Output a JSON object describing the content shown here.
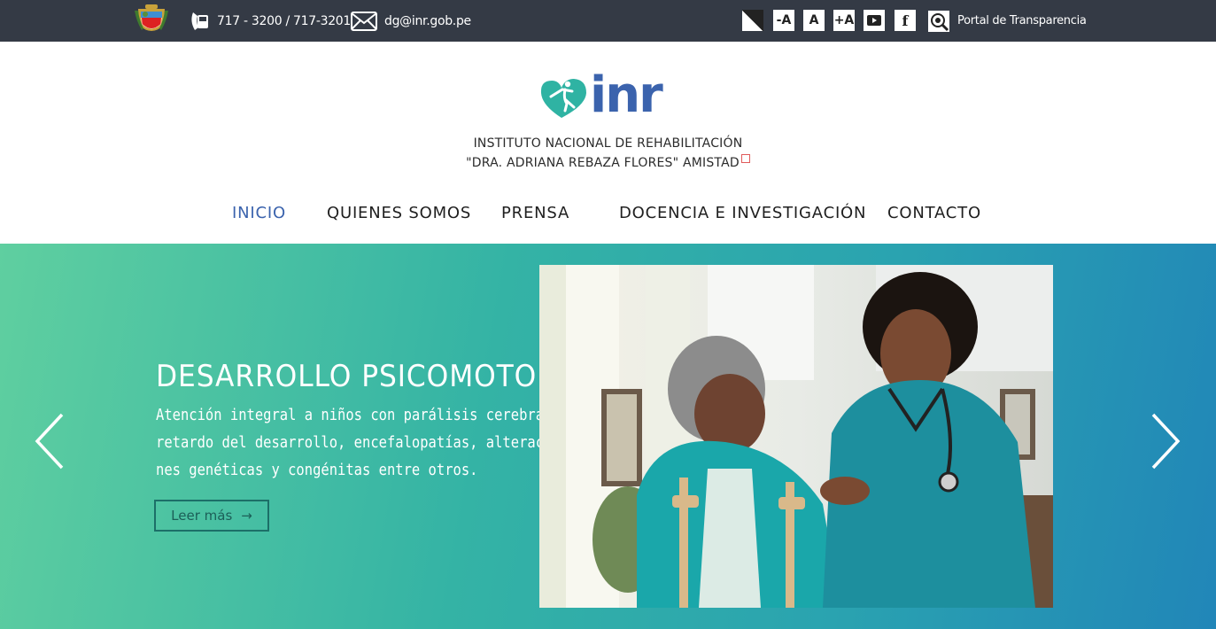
{
  "topbar": {
    "phone": "717 - 3200 / 717-3201",
    "email": "dg@inr.gob.pe",
    "accessibility": {
      "decrease_label": "-A",
      "normal_label": "A",
      "increase_label": "+A"
    },
    "facebook_label": "f",
    "transparency_label": "Portal de Transparencia"
  },
  "header": {
    "logo_text": "inr",
    "institute_line1": "INSTITUTO NACIONAL DE REHABILITACIÓN",
    "institute_line2": "\"DRA. ADRIANA REBAZA  FLORES\" AMISTAD"
  },
  "nav": [
    {
      "label": "INICIO",
      "active": true
    },
    {
      "label": "QUIENES SOMOS",
      "active": false
    },
    {
      "label": "PRENSA",
      "active": false
    },
    {
      "label": "DOCENCIA E INVESTIGACIÓN",
      "active": false
    },
    {
      "label": "CONTACTO",
      "active": false
    }
  ],
  "hero": {
    "title": "DESARROLLO PSICOMOTOR",
    "description_lines": [
      "Atención integral a niños con parálisis cerebral,",
      "retardo del desarrollo, encefalopatías, alteracio-",
      "nes genéticas y congénitas entre otros."
    ],
    "button_label": "Leer más",
    "button_arrow": "→"
  },
  "colors": {
    "topbar_bg": "#343a45",
    "nav_active": "#3b63ad",
    "brand_teal": "#2fb3a3",
    "brand_blue": "#3b63ad",
    "hero_gradient_start": "#5fcfa0",
    "hero_gradient_end": "#2186b8"
  },
  "icons": {
    "coat_of_arms": "peru-coat-of-arms-icon",
    "phone": "phone-icon",
    "email": "envelope-icon",
    "contrast": "contrast-icon",
    "youtube": "youtube-icon",
    "facebook": "facebook-icon",
    "transparency": "transparency-portal-icon",
    "prev": "chevron-left-icon",
    "next": "chevron-right-icon"
  }
}
